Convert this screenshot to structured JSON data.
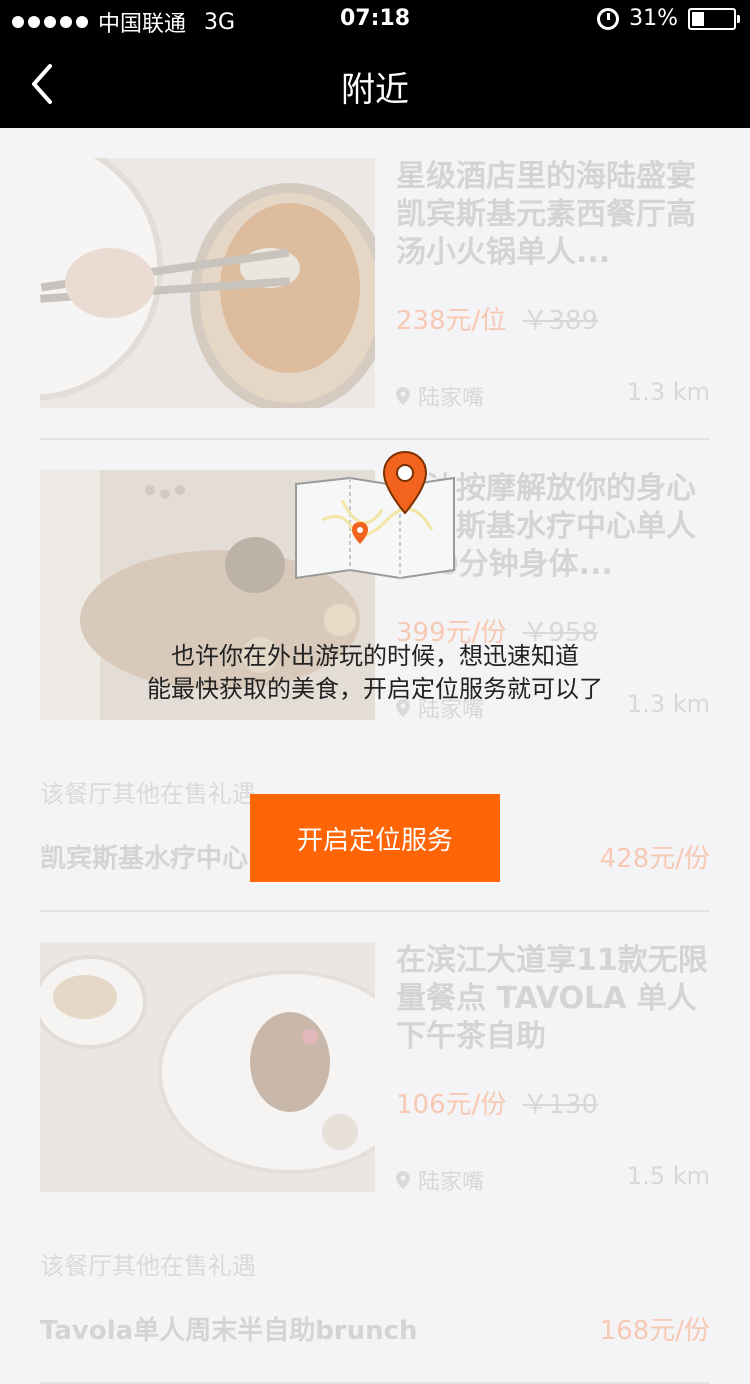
{
  "status_bar": {
    "carrier": "中国联通",
    "network": "3G",
    "time": "07:18",
    "battery": "31%"
  },
  "nav": {
    "title": "附近"
  },
  "deals": [
    {
      "name": "星级酒店里的海陆盛宴 凯宾斯基元素西餐厅高汤小火锅单人...",
      "price": "238元/位",
      "original_price": "￥389",
      "location": "陆家嘴",
      "distance": "1.3 km"
    },
    {
      "name": "精油按摩解放你的身心 凯宾斯基水疗中心单人100分钟身体...",
      "price": "399元/份",
      "original_price": "￥958",
      "location": "陆家嘴",
      "distance": "1.3 km",
      "other_header": "该餐厅其他在售礼遇",
      "other_name": "凯宾斯基水疗中心...",
      "other_price": "428元/份"
    },
    {
      "name": "在滨江大道享11款无限量餐点 TAVOLA 单人下午茶自助",
      "price": "106元/份",
      "original_price": "￥130",
      "location": "陆家嘴",
      "distance": "1.5 km",
      "other_header": "该餐厅其他在售礼遇",
      "other_name": "Tavola单人周末半自助brunch",
      "other_price": "168元/份"
    }
  ],
  "overlay": {
    "line1": "也许你在外出游玩的时候，想迅速知道",
    "line2": "能最快获取的美食，开启定位服务就可以了",
    "button": "开启定位服务"
  },
  "colors": {
    "accent": "#ff6405",
    "pin": "#f2641d"
  }
}
